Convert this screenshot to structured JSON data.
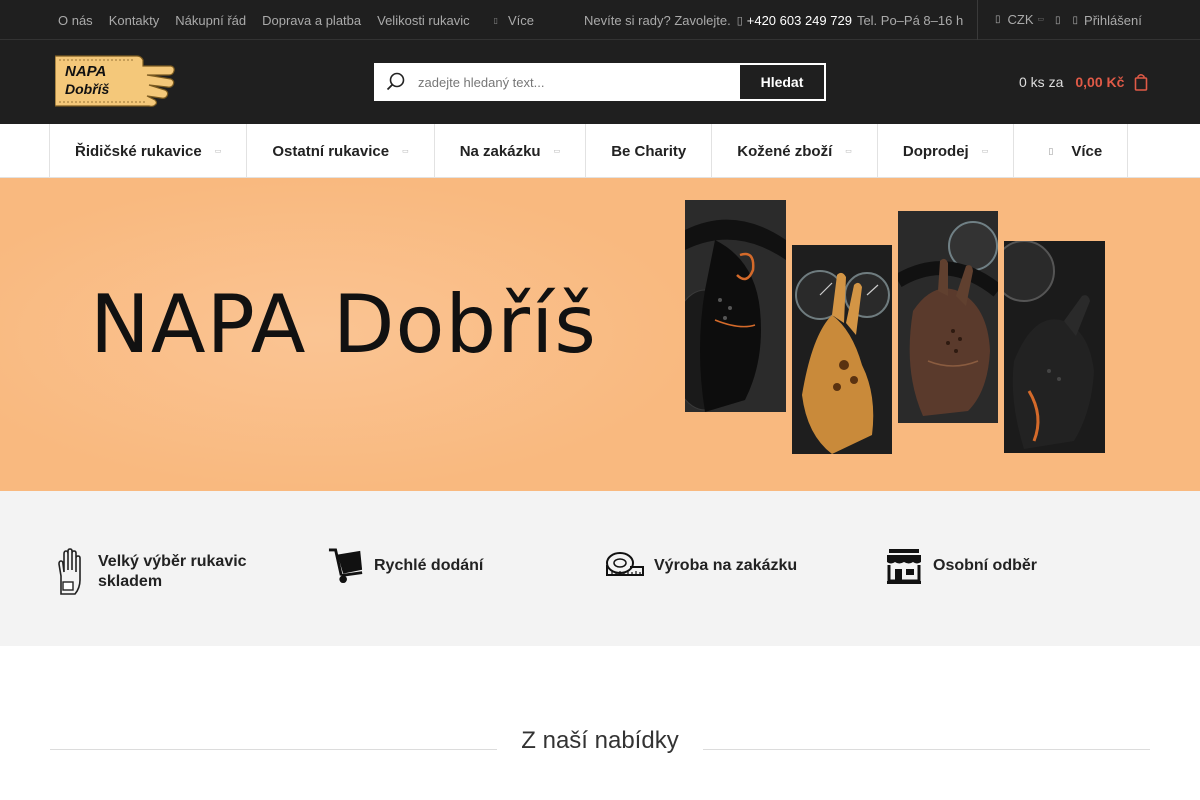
{
  "topbar": {
    "links": [
      "O nás",
      "Kontakty",
      "Nákupní řád",
      "Doprava a platba",
      "Velikosti rukavic"
    ],
    "more_label": "Více",
    "contact_prompt": "Nevíte si rady? Zavolejte.",
    "phone": "+420 603 249 729",
    "hours": "Tel. Po–Pá 8–16 h",
    "currency": "CZK",
    "login_label": "Přihlášení"
  },
  "header": {
    "logo_line1": "NAPA",
    "logo_line2": "Dobříš",
    "search_placeholder": "zadejte hledaný text...",
    "search_button": "Hledat",
    "cart_count": "0 ks za",
    "cart_price": "0,00 Kč"
  },
  "nav": {
    "items": [
      {
        "label": "Řidičské rukavice",
        "dropdown": true
      },
      {
        "label": "Ostatní rukavice",
        "dropdown": true
      },
      {
        "label": "Na zakázku",
        "dropdown": true
      },
      {
        "label": "Be Charity",
        "dropdown": false
      },
      {
        "label": "Kožené zboží",
        "dropdown": true
      },
      {
        "label": "Doprodej",
        "dropdown": true
      },
      {
        "label": "Více",
        "dropdown": false
      }
    ]
  },
  "banner": {
    "title": "NAPA Dobříš"
  },
  "features": [
    {
      "icon": "glove-icon",
      "line1": "Velký výběr rukavic",
      "line2": "skladem"
    },
    {
      "icon": "hand-truck-icon",
      "line1": "Rychlé dodání",
      "line2": ""
    },
    {
      "icon": "measuring-tape-icon",
      "line1": "Výroba na zakázku",
      "line2": ""
    },
    {
      "icon": "store-icon",
      "line1": "Osobní odběr",
      "line2": ""
    }
  ],
  "section": {
    "title": "Z naší nabídky"
  },
  "colors": {
    "dark": "#1f1f1f",
    "accent_price": "#e05a47",
    "banner_bg": "#f9b97f"
  }
}
